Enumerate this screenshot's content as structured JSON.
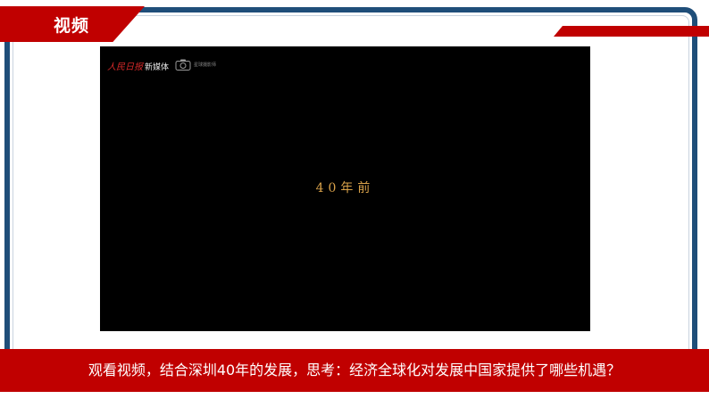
{
  "slide": {
    "title": "视频",
    "question": "观看视频，结合深圳40年的发展，思考：经济全球化对发展中国家提供了哪些机遇？"
  },
  "video": {
    "watermark_brand": "人民日报",
    "watermark_sub": "新媒体",
    "camera_label": "星球摄影师",
    "caption": "40年前",
    "camera_icon": "camera-icon"
  },
  "colors": {
    "accent_red": "#c00000",
    "frame_blue": "#1f4e79",
    "caption_gold": "#d9a24a"
  }
}
